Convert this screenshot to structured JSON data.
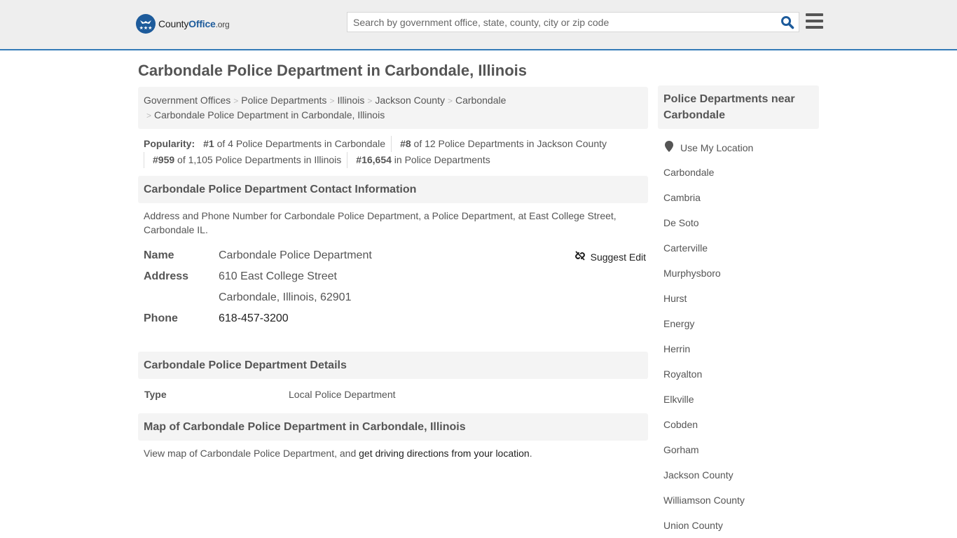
{
  "header": {
    "logo": {
      "name_part1": "County",
      "name_part2": "Office",
      "name_part3": ".org"
    },
    "search_placeholder": "Search by government office, state, county, city or zip code",
    "search_icon": "search-icon",
    "menu_icon": "hamburger-menu-icon",
    "accent_color": "#337ab7"
  },
  "page_title": "Carbondale Police Department in Carbondale, Illinois",
  "breadcrumb": [
    {
      "label": "Government Offices"
    },
    {
      "label": "Police Departments"
    },
    {
      "label": "Illinois"
    },
    {
      "label": "Jackson County"
    },
    {
      "label": "Carbondale"
    },
    {
      "label": "Carbondale Police Department in Carbondale, Illinois"
    }
  ],
  "popularity": {
    "label": "Popularity:",
    "items": [
      {
        "rank": "#1",
        "text": " of 4 Police Departments in Carbondale"
      },
      {
        "rank": "#8",
        "text": " of 12 Police Departments in Jackson County"
      },
      {
        "rank": "#959",
        "text": " of 1,105 Police Departments in Illinois"
      },
      {
        "rank": "#16,654",
        "text": " in Police Departments"
      }
    ]
  },
  "contact": {
    "heading": "Carbondale Police Department Contact Information",
    "description": "Address and Phone Number for Carbondale Police Department, a Police Department, at East College Street, Carbondale IL.",
    "suggest_edit": "Suggest Edit",
    "name_label": "Name",
    "name_value": "Carbondale Police Department",
    "address_label": "Address",
    "address_line1": "610 East College Street",
    "address_line2": "Carbondale, Illinois, 62901",
    "phone_label": "Phone",
    "phone_value": "618-457-3200"
  },
  "details": {
    "heading": "Carbondale Police Department Details",
    "type_label": "Type",
    "type_value": "Local Police Department"
  },
  "map": {
    "heading": "Map of Carbondale Police Department in Carbondale, Illinois",
    "text_prefix": "View map of Carbondale Police Department, and ",
    "link_text": "get driving directions from your location",
    "text_suffix": "."
  },
  "sidebar": {
    "heading": "Police Departments near Carbondale",
    "use_location": "Use My Location",
    "links": [
      "Carbondale",
      "Cambria",
      "De Soto",
      "Carterville",
      "Murphysboro",
      "Hurst",
      "Energy",
      "Herrin",
      "Royalton",
      "Elkville",
      "Cobden",
      "Gorham",
      "Jackson County",
      "Williamson County",
      "Union County"
    ]
  }
}
